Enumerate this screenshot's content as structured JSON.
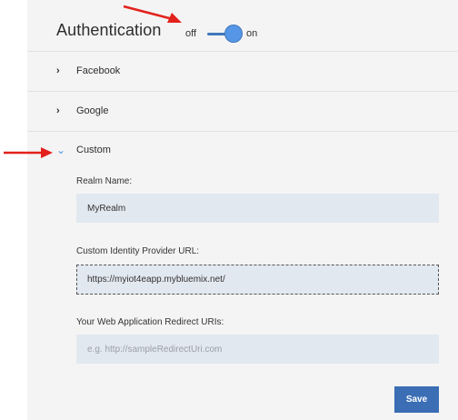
{
  "auth": {
    "title": "Authentication",
    "toggle_off": "off",
    "toggle_on": "on",
    "toggle_state": true
  },
  "providers": [
    {
      "label": "Facebook",
      "expanded": false
    },
    {
      "label": "Google",
      "expanded": false
    },
    {
      "label": "Custom",
      "expanded": true
    }
  ],
  "custom": {
    "realm_label": "Realm Name:",
    "realm_value": "MyRealm",
    "idp_label": "Custom Identity Provider URL:",
    "idp_value": "https://myiot4eapp.mybluemix.net/",
    "redirect_label": "Your Web Application Redirect URIs:",
    "redirect_placeholder": "e.g. http://sampleRedirectUri.com",
    "save_label": "Save"
  },
  "colors": {
    "accent": "#5596e6",
    "button": "#3b6eb4",
    "annotation_arrow": "#e3211c"
  }
}
